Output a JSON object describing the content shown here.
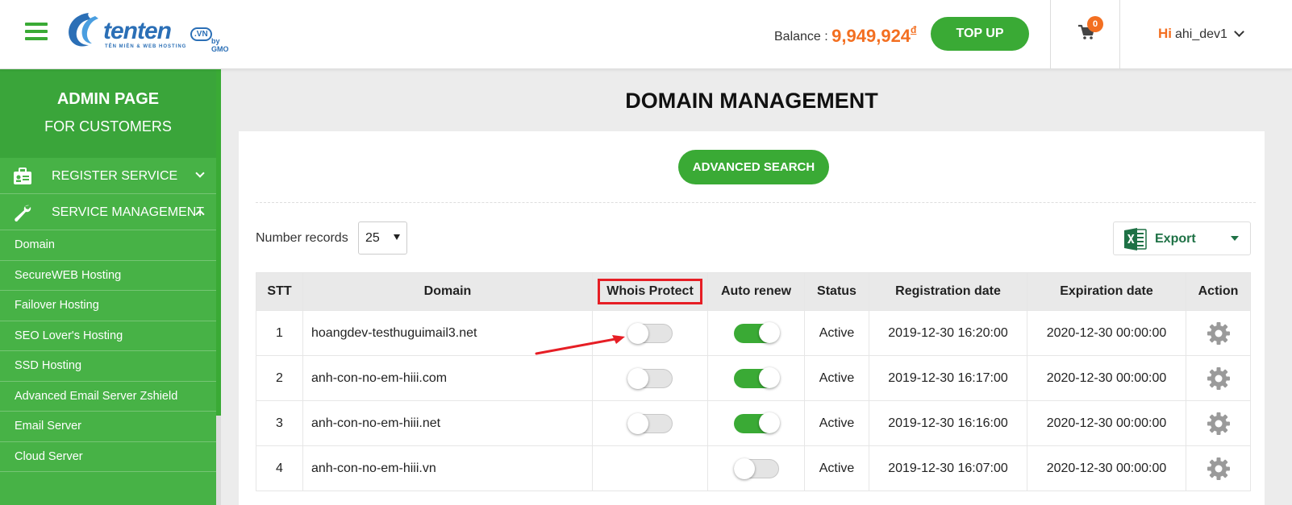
{
  "header": {
    "logo_text": "tenten",
    "logo_vn": ".VN",
    "logo_gmo": "by GMO",
    "logo_tagline": "TÊN MIỀN & WEB HOSTING",
    "balance_label": "Balance :",
    "balance_amount": "9,949,924",
    "balance_currency": "đ",
    "topup_label": "TOP UP",
    "cart_count": "0",
    "greeting": "Hi",
    "username": "ahi_dev1"
  },
  "sidebar": {
    "admin_title": "ADMIN PAGE",
    "admin_subtitle": "FOR CUSTOMERS",
    "menu": [
      {
        "label": "REGISTER SERVICE",
        "icon": "id-card-icon",
        "expanded": false
      },
      {
        "label": "SERVICE MANAGEMENT",
        "icon": "wrench-icon",
        "expanded": true
      }
    ],
    "sub_items": [
      "Domain",
      "SecureWEB Hosting",
      "Failover Hosting",
      "SEO Lover's Hosting",
      "SSD Hosting",
      "Advanced Email Server Zshield",
      "Email Server",
      "Cloud Server"
    ]
  },
  "main": {
    "title": "DOMAIN MANAGEMENT",
    "advanced_search": "ADVANCED SEARCH",
    "number_records_label": "Number records",
    "number_records_value": "25",
    "export_label": "Export",
    "columns": [
      "STT",
      "Domain",
      "Whois Protect",
      "Auto renew",
      "Status",
      "Registration date",
      "Expiration date",
      "Action"
    ],
    "rows": [
      {
        "stt": "1",
        "domain": "hoangdev-testhuguimail3.net",
        "whois": false,
        "whois_shown": true,
        "auto_renew": true,
        "status": "Active",
        "registration": "2019-12-30 16:20:00",
        "expiration": "2020-12-30 00:00:00"
      },
      {
        "stt": "2",
        "domain": "anh-con-no-em-hiii.com",
        "whois": false,
        "whois_shown": true,
        "auto_renew": true,
        "status": "Active",
        "registration": "2019-12-30 16:17:00",
        "expiration": "2020-12-30 00:00:00"
      },
      {
        "stt": "3",
        "domain": "anh-con-no-em-hiii.net",
        "whois": false,
        "whois_shown": true,
        "auto_renew": true,
        "status": "Active",
        "registration": "2019-12-30 16:16:00",
        "expiration": "2020-12-30 00:00:00"
      },
      {
        "stt": "4",
        "domain": "anh-con-no-em-hiii.vn",
        "whois": false,
        "whois_shown": false,
        "auto_renew": false,
        "status": "Active",
        "registration": "2019-12-30 16:07:00",
        "expiration": "2020-12-30 00:00:00"
      }
    ]
  },
  "colors": {
    "brand_green": "#3aaa35",
    "accent_orange": "#f36f21",
    "highlight_red": "#e61e25",
    "logo_blue": "#2b6fb6"
  }
}
